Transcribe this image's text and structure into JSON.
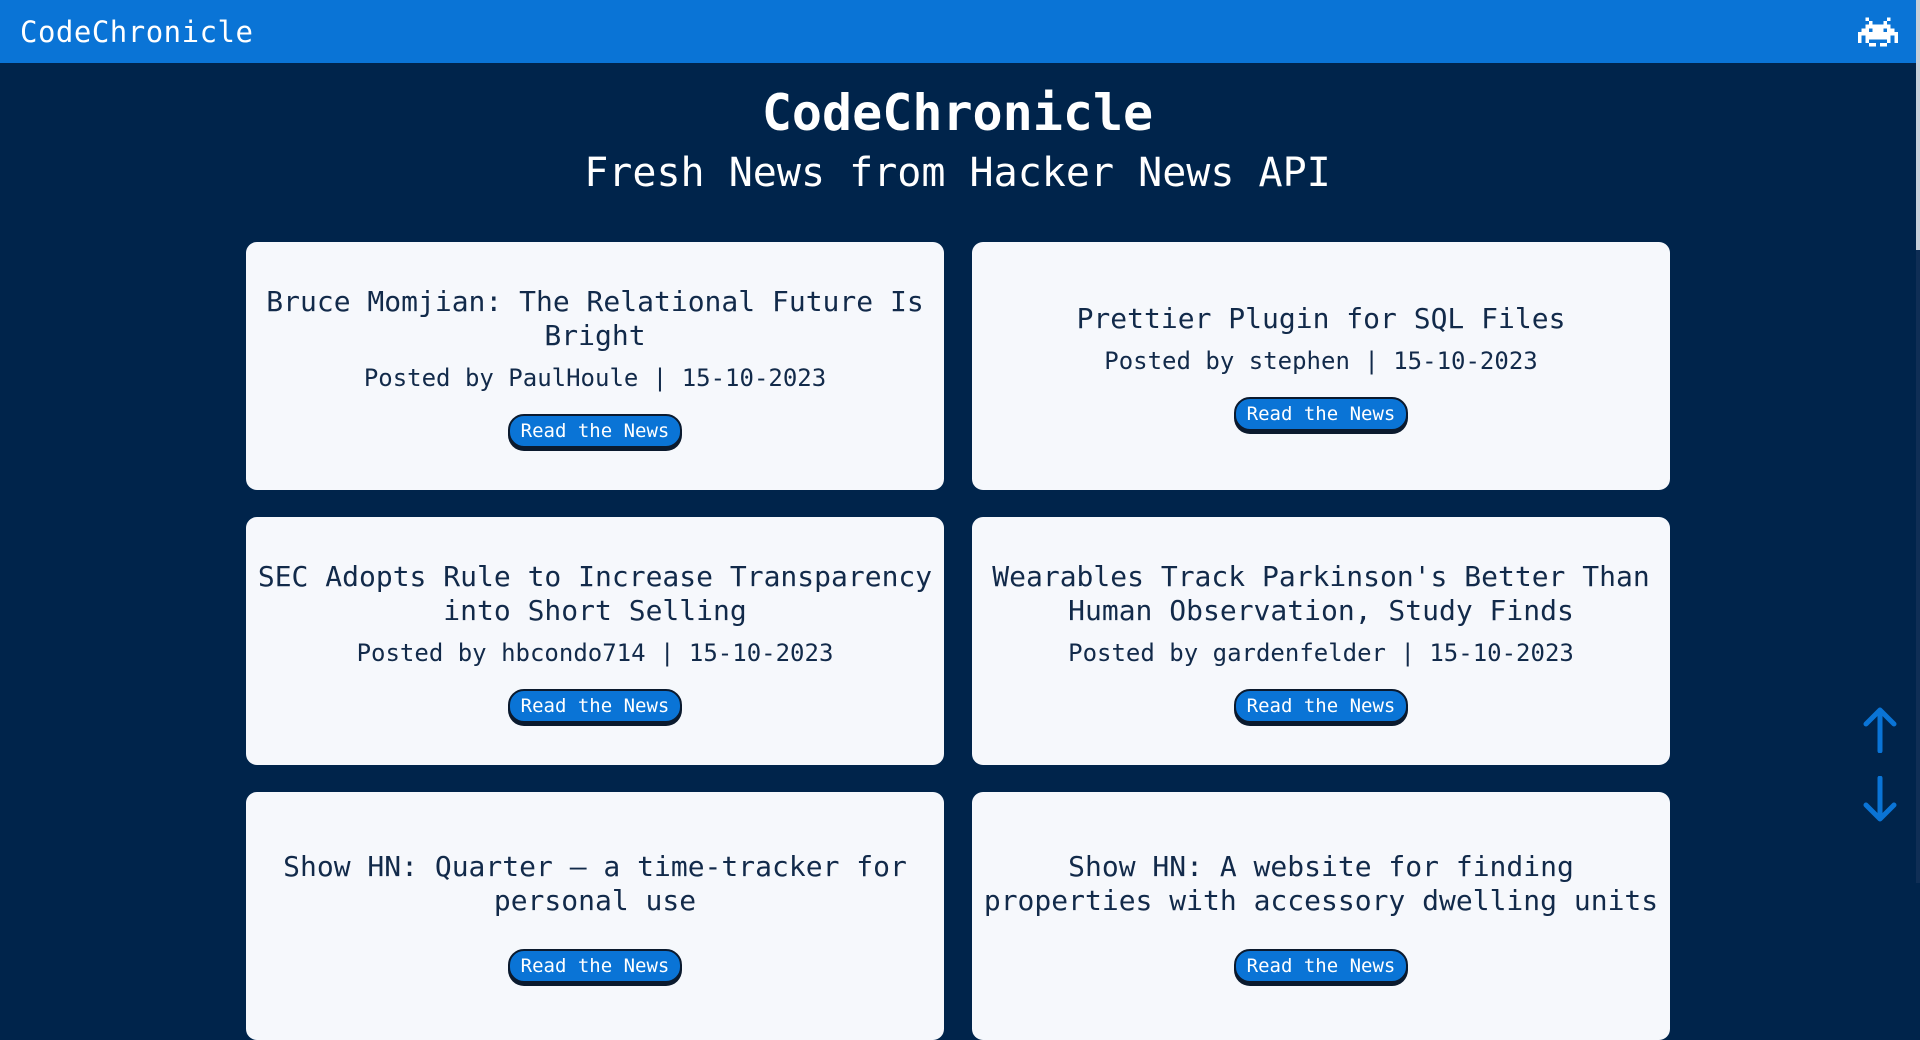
{
  "nav": {
    "brand": "CodeChronicle",
    "icon": "space-invader-icon"
  },
  "hero": {
    "title": "CodeChronicle",
    "subtitle": "Fresh News from Hacker News API"
  },
  "colors": {
    "background": "#00244b",
    "accent": "#0a74d6",
    "card": "#f6f8fc",
    "card_text": "#122a4a"
  },
  "button_label": "Read the News",
  "articles": [
    {
      "title": "Bruce Momjian: The Relational Future Is Bright",
      "meta": "Posted by PaulHoule | 15-10-2023",
      "author": "PaulHoule",
      "date": "15-10-2023",
      "button": "Read the News"
    },
    {
      "title": "Prettier Plugin for SQL Files",
      "meta": "Posted by stephen | 15-10-2023",
      "author": "stephen",
      "date": "15-10-2023",
      "button": "Read the News"
    },
    {
      "title": "SEC Adopts Rule to Increase Transparency into Short Selling",
      "meta": "Posted by hbcondo714 | 15-10-2023",
      "author": "hbcondo714",
      "date": "15-10-2023",
      "button": "Read the News"
    },
    {
      "title": "Wearables Track Parkinson's Better Than Human Observation, Study Finds",
      "meta": "Posted by gardenfelder | 15-10-2023",
      "author": "gardenfelder",
      "date": "15-10-2023",
      "button": "Read the News"
    },
    {
      "title": "Show HN: Quarter – a time-tracker for personal use",
      "meta": "",
      "button": "Read the News"
    },
    {
      "title": "Show HN: A website for finding properties with accessory dwelling units",
      "meta": "",
      "button": "Read the News"
    }
  ],
  "scroll_controls": {
    "up_icon": "arrow-up-icon",
    "down_icon": "arrow-down-icon"
  }
}
